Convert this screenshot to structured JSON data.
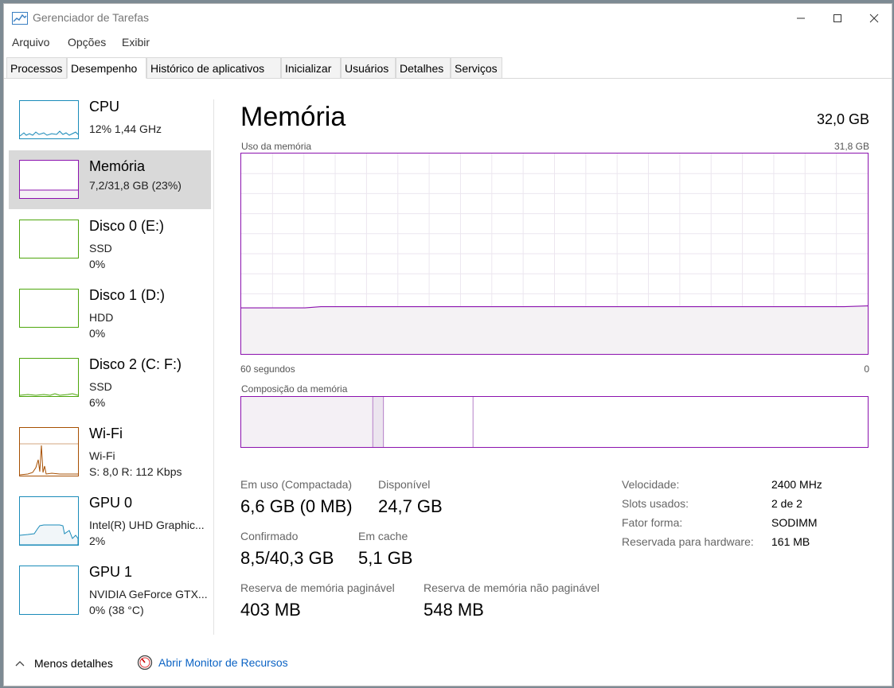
{
  "window": {
    "title": "Gerenciador de Tarefas"
  },
  "menu": [
    "Arquivo",
    "Opções",
    "Exibir"
  ],
  "tabs": [
    "Processos",
    "Desempenho",
    "Histórico de aplicativos",
    "Inicializar",
    "Usuários",
    "Detalhes",
    "Serviços"
  ],
  "sidebar": {
    "items": [
      {
        "name": "CPU",
        "line1": "12%  1,44 GHz",
        "line2": "",
        "color": "#1a8bb9"
      },
      {
        "name": "Memória",
        "line1": "7,2/31,8 GB (23%)",
        "line2": "",
        "color": "#8b12ae"
      },
      {
        "name": "Disco 0 (E:)",
        "line1": "SSD",
        "line2": "0%",
        "color": "#4da60c"
      },
      {
        "name": "Disco 1 (D:)",
        "line1": "HDD",
        "line2": "0%",
        "color": "#4da60c"
      },
      {
        "name": "Disco 2 (C: F:)",
        "line1": "SSD",
        "line2": "6%",
        "color": "#4da60c"
      },
      {
        "name": "Wi-Fi",
        "line1": "Wi-Fi",
        "line2": "S: 8,0 R: 112 Kbps",
        "color": "#a74f01"
      },
      {
        "name": "GPU 0",
        "line1": "Intel(R) UHD Graphic...",
        "line2": "2%",
        "color": "#1a8bb9"
      },
      {
        "name": "GPU 1",
        "line1": "NVIDIA GeForce GTX...",
        "line2": "0% (38 °C)",
        "color": "#1a8bb9"
      }
    ]
  },
  "main": {
    "title": "Memória",
    "total": "32,0 GB",
    "usage_label": "Uso da memória",
    "usage_max": "31,8 GB",
    "time_left": "60 segundos",
    "time_right": "0",
    "usage_fraction": 0.23,
    "composition_label": "Composição da memória",
    "composition": {
      "in_use_fraction": 0.21,
      "modified_fraction": 0.017,
      "standby_fraction": 0.143
    },
    "stats": {
      "in_use_label": "Em uso (Compactada)",
      "in_use_value": "6,6 GB (0 MB)",
      "available_label": "Disponível",
      "available_value": "24,7 GB",
      "committed_label": "Confirmado",
      "committed_value": "8,5/40,3 GB",
      "cached_label": "Em cache",
      "cached_value": "5,1 GB",
      "paged_label": "Reserva de memória paginável",
      "paged_value": "403 MB",
      "nonpaged_label": "Reserva de memória não paginável",
      "nonpaged_value": "548 MB"
    },
    "specs": [
      {
        "label": "Velocidade:",
        "value": "2400 MHz"
      },
      {
        "label": "Slots usados:",
        "value": "2 de 2"
      },
      {
        "label": "Fator forma:",
        "value": "SODIMM"
      },
      {
        "label": "Reservada para hardware:",
        "value": "161 MB"
      }
    ]
  },
  "footer": {
    "less_details": "Menos detalhes",
    "resource_monitor": "Abrir Monitor de Recursos"
  },
  "colors": {
    "memory": "#8b12ae",
    "memory_fill": "#f4f2f4",
    "link": "#0b63c4"
  }
}
